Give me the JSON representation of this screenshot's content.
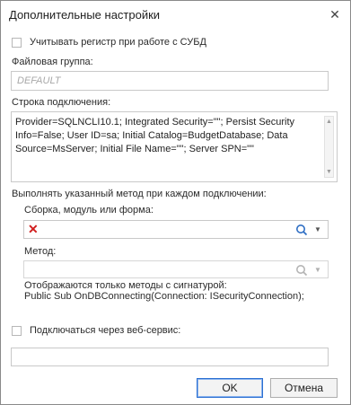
{
  "dialog": {
    "title": "Дополнительные настройки",
    "close_glyph": "✕"
  },
  "case_sensitive": {
    "label": "Учитывать регистр при работе с СУБД",
    "checked": false
  },
  "file_group": {
    "label": "Файловая группа:",
    "placeholder": "DEFAULT"
  },
  "connection_string": {
    "label": "Строка подключения:",
    "value": "Provider=SQLNCLI10.1; Integrated Security=\"\"; Persist Security\nInfo=False; User ID=sa; Initial Catalog=BudgetDatabase; Data\nSource=MsServer; Initial File Name=\"\"; Server SPN=\"\""
  },
  "on_connect": {
    "label": "Выполнять указанный метод при каждом подключении:",
    "assembly_label": "Сборка, модуль или форма:",
    "method_label": "Метод:",
    "hint_line1": "Отображаются только методы с сигнатурой:",
    "hint_line2": "Public Sub OnDBConnecting(Connection: ISecurityConnection);"
  },
  "web_service": {
    "label": "Подключаться через веб-сервис:",
    "checked": false
  },
  "buttons": {
    "ok": "OK",
    "cancel": "Отмена"
  },
  "colors": {
    "accent": "#2b6fd1",
    "error_icon": "#d11f1f"
  }
}
